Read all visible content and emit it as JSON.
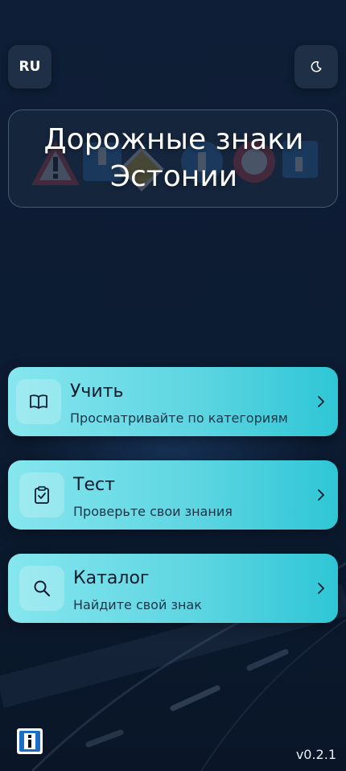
{
  "header": {
    "language_label": "RU",
    "theme_icon": "moon-icon"
  },
  "title": {
    "text": "Дорожные знаки\nЭстонии",
    "background_icons": [
      "warning-triangle-sign-icon",
      "square-info-sign-icon",
      "priority-diamond-sign-icon",
      "round-blue-sign-icon",
      "round-red-sign-icon",
      "square-info-sign-icon"
    ]
  },
  "menu": [
    {
      "title": "Учить",
      "subtitle": "Просматривайте по категориям",
      "icon": "book-icon"
    },
    {
      "title": "Тест",
      "subtitle": "Проверьте свои знания",
      "icon": "clipboard-check-icon"
    },
    {
      "title": "Каталог",
      "subtitle": "Найдите свой знак",
      "icon": "search-icon"
    }
  ],
  "footer": {
    "info_icon": "info-sign-icon",
    "version": "v0.2.1"
  },
  "colors": {
    "background": "#0c1b31",
    "card_start": "#86e6ee",
    "card_end": "#2ec6d6",
    "card_text": "#0d1b2d",
    "info_blue": "#1b6fc2"
  }
}
